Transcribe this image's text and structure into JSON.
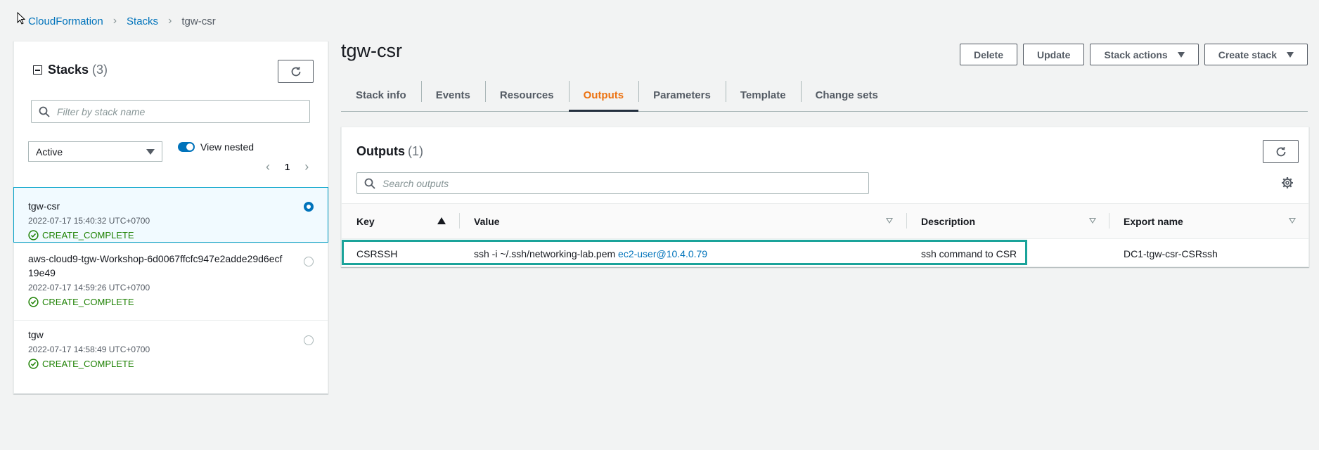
{
  "breadcrumb": {
    "root": "CloudFormation",
    "section": "Stacks",
    "current": "tgw-csr"
  },
  "sidebar": {
    "title": "Stacks",
    "count": "(3)",
    "filter_placeholder": "Filter by stack name",
    "status_filter": "Active",
    "view_nested_label": "View nested",
    "page": "1",
    "stacks": [
      {
        "name": "tgw-csr",
        "time": "2022-07-17 15:40:32 UTC+0700",
        "status": "CREATE_COMPLETE",
        "selected": true
      },
      {
        "name": "aws-cloud9-tgw-Workshop-6d0067ffcfc947e2adde29d6ecf19e49",
        "time": "2022-07-17 14:59:26 UTC+0700",
        "status": "CREATE_COMPLETE",
        "selected": false
      },
      {
        "name": "tgw",
        "time": "2022-07-17 14:58:49 UTC+0700",
        "status": "CREATE_COMPLETE",
        "selected": false
      }
    ]
  },
  "page": {
    "title": "tgw-csr"
  },
  "actions": {
    "delete": "Delete",
    "update": "Update",
    "stack_actions": "Stack actions",
    "create_stack": "Create stack"
  },
  "tabs": [
    "Stack info",
    "Events",
    "Resources",
    "Outputs",
    "Parameters",
    "Template",
    "Change sets"
  ],
  "outputs": {
    "title": "Outputs",
    "count": "(1)",
    "search_placeholder": "Search outputs",
    "columns": [
      "Key",
      "Value",
      "Description",
      "Export name"
    ],
    "rows": [
      {
        "key": "CSRSSH",
        "value_prefix": "ssh -i ~/.ssh/networking-lab.pem ",
        "value_link": "ec2-user@10.4.0.79",
        "description": "ssh command to CSR",
        "export_name": "DC1-tgw-csr-CSRssh"
      }
    ]
  },
  "colors": {
    "link": "#0073bb",
    "active_tab": "#ec7211",
    "success": "#1d8102",
    "highlight": "#1aa39a"
  },
  "icons": [
    "cursor-arrow-icon",
    "collapse-icon",
    "refresh-icon",
    "search-icon",
    "caret-down-icon",
    "chevron-left-icon",
    "chevron-right-icon",
    "check-circle-icon",
    "gear-icon",
    "sort-ascending-icon",
    "sort-icon"
  ]
}
